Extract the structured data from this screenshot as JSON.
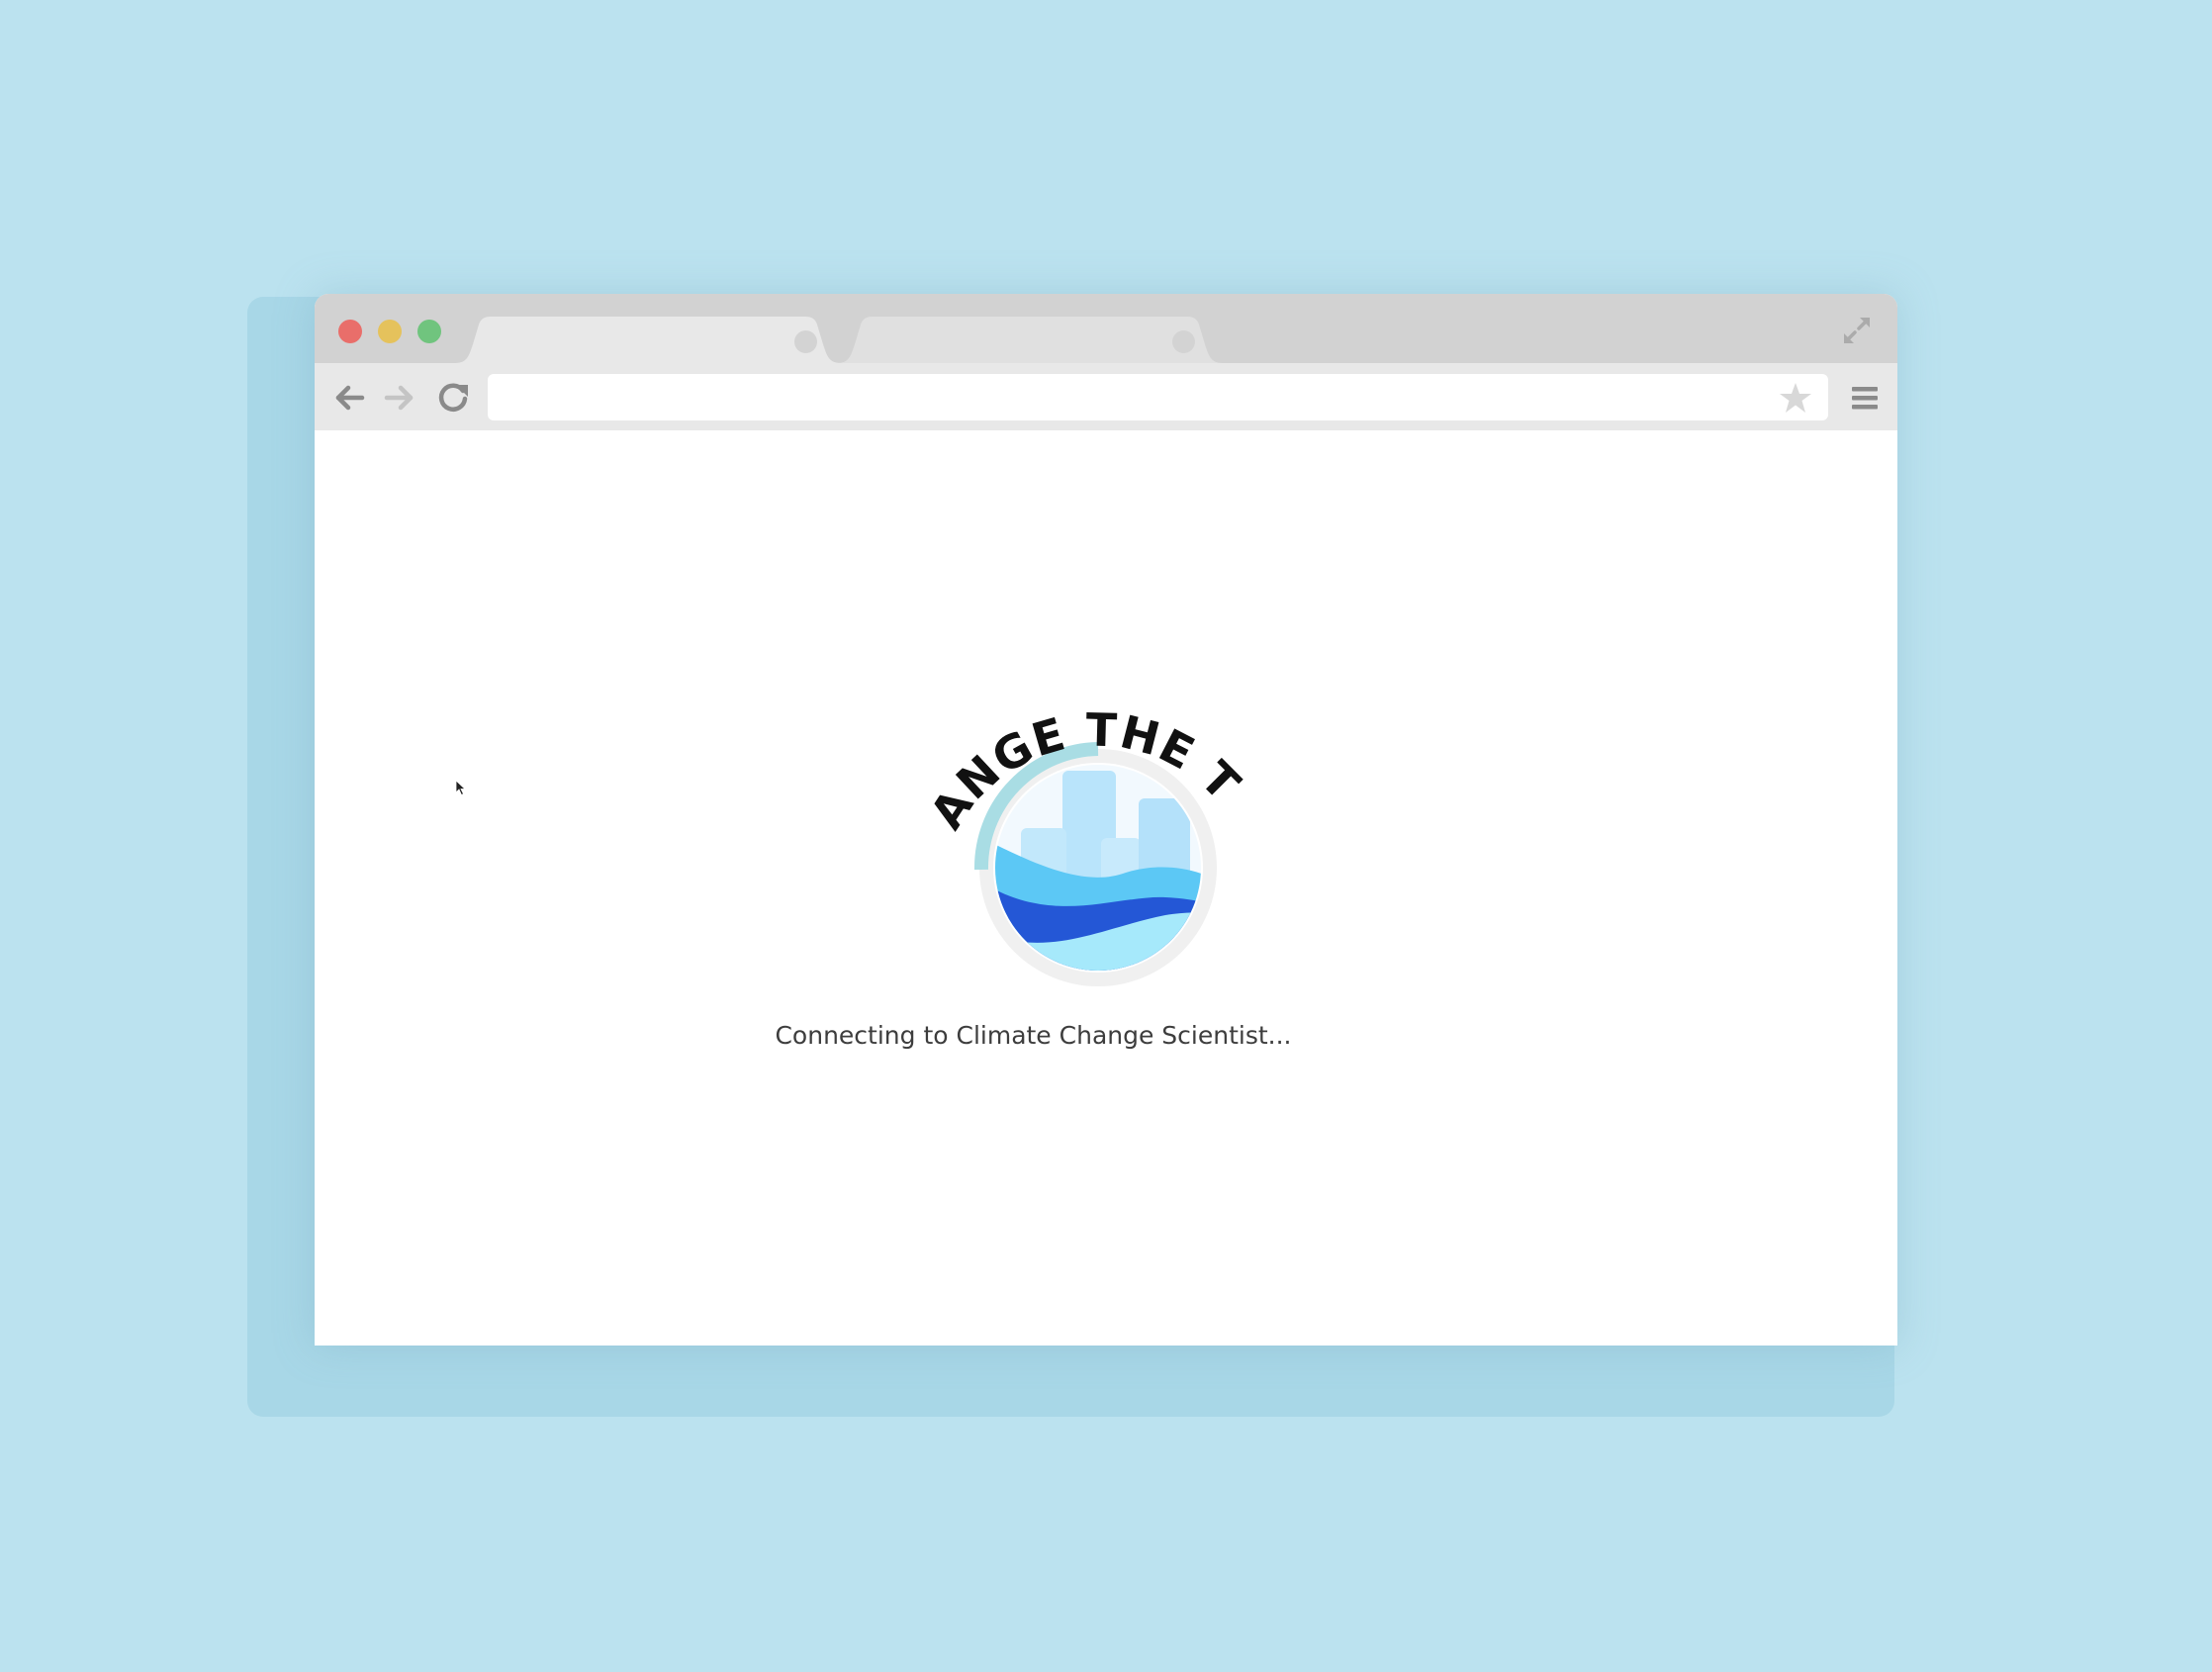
{
  "browser": {
    "tabs": [
      {
        "label": ""
      },
      {
        "label": ""
      }
    ],
    "address_bar": {
      "value": "",
      "placeholder": ""
    },
    "icons": {
      "close": "red-close-light",
      "minimize": "yellow-minimize-light",
      "zoom": "green-zoom-light",
      "back": "back-arrow-icon",
      "forward": "forward-arrow-icon",
      "reload": "reload-icon",
      "bookmark": "star-icon",
      "menu": "hamburger-menu-icon",
      "fullscreen": "expand-icon"
    }
  },
  "page": {
    "logo_text": "CHANGE THE TIDE",
    "status": "Connecting to Climate Change Scientist..."
  },
  "colors": {
    "background": "#bbe2ef",
    "titlebar": "#d2d2d2",
    "toolbar": "#e8e8e8",
    "wave_dark": "#2457d6",
    "wave_light": "#5cc8f5",
    "buildings": "#b9e4fb"
  }
}
